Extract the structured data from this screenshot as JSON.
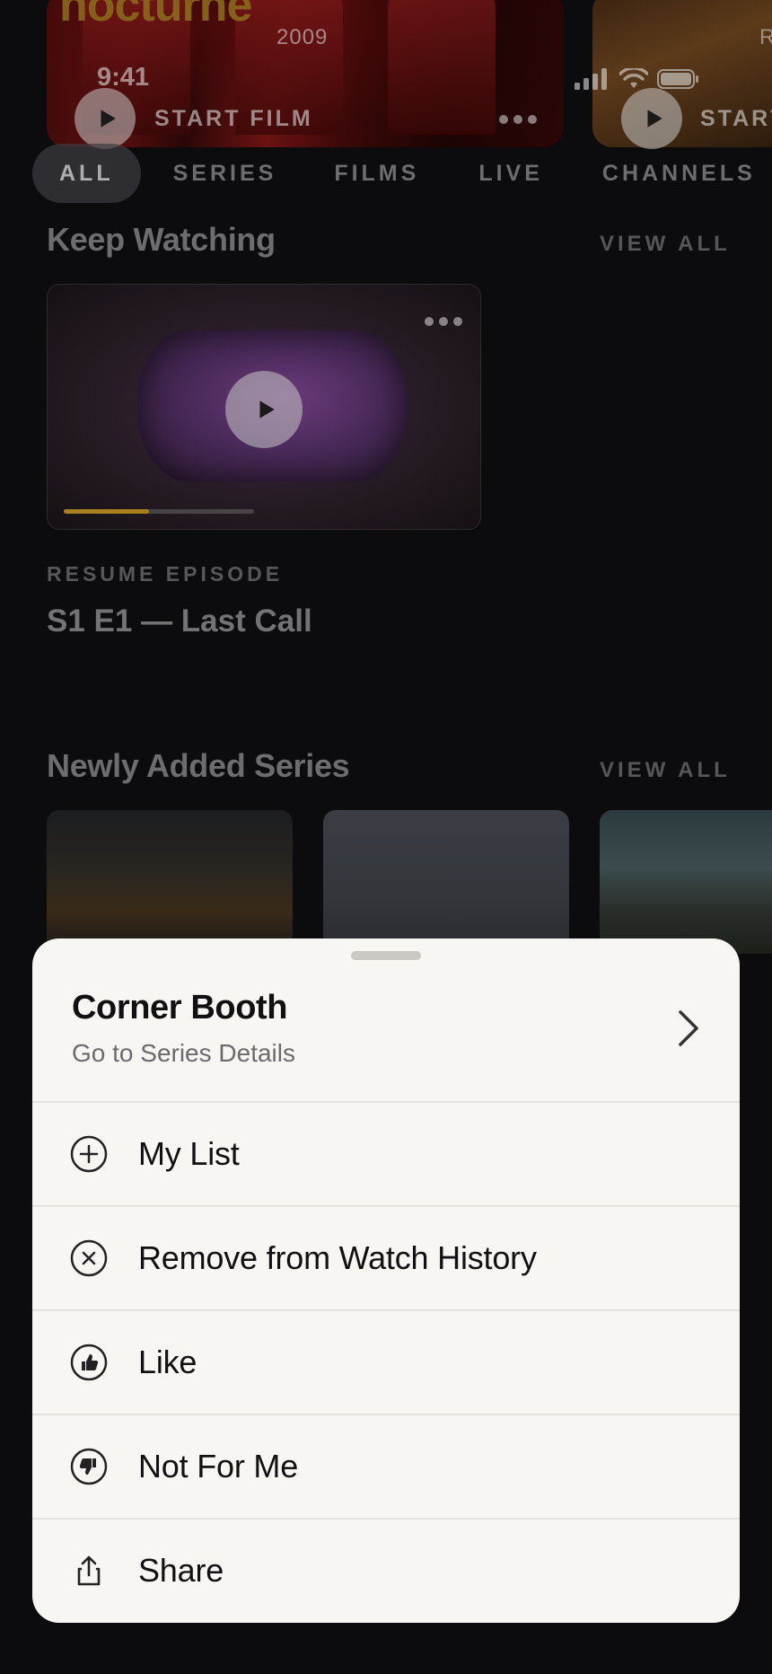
{
  "status_bar": {
    "time": "9:41"
  },
  "hero": {
    "cards": [
      {
        "title_art": "nocturne",
        "year": "2009",
        "action_label": "START FILM"
      },
      {
        "title_art": "",
        "year": "R",
        "action_label": "START"
      }
    ]
  },
  "filter_tabs": [
    {
      "label": "ALL",
      "active": true
    },
    {
      "label": "SERIES",
      "active": false
    },
    {
      "label": "FILMS",
      "active": false
    },
    {
      "label": "LIVE",
      "active": false
    },
    {
      "label": "CHANNELS",
      "active": false
    }
  ],
  "keep_watching": {
    "title": "Keep Watching",
    "view_all": "VIEW ALL",
    "item": {
      "progress_fraction": 0.45,
      "resume_label": "RESUME EPISODE",
      "episode_title": "S1 E1 — Last Call"
    }
  },
  "newly_added": {
    "title": "Newly Added Series",
    "view_all": "VIEW ALL"
  },
  "sheet": {
    "title": "Corner Booth",
    "subtitle": "Go to Series Details",
    "actions": [
      {
        "label": "My List",
        "icon": "plus-circle-icon"
      },
      {
        "label": "Remove from Watch History",
        "icon": "x-circle-icon"
      },
      {
        "label": "Like",
        "icon": "thumbs-up-icon"
      },
      {
        "label": "Not For Me",
        "icon": "thumbs-down-icon"
      },
      {
        "label": "Share",
        "icon": "share-icon"
      }
    ]
  },
  "colors": {
    "background": "#0c0c0e",
    "sheet_background": "#f7f6f3",
    "progress_accent": "#a8801e"
  }
}
